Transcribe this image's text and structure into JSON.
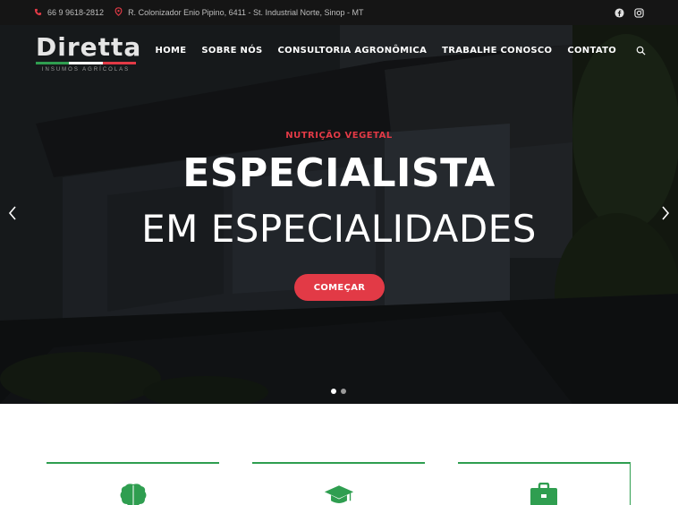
{
  "topbar": {
    "phone": "66 9 9618-2812",
    "address": "R. Colonizador Enio Pipino, 6411 - St. Industrial Norte, Sinop - MT",
    "socials": [
      "facebook-icon",
      "instagram-icon"
    ]
  },
  "brand": {
    "name": "Diretta",
    "tagline": "INSUMOS AGRÍCOLAS",
    "colors": {
      "green": "#2f9e50",
      "white": "#ffffff",
      "red": "#e23a46"
    }
  },
  "nav": {
    "items": [
      "HOME",
      "SOBRE NÓS",
      "CONSULTORIA AGRONÔMICA",
      "TRABALHE CONOSCO",
      "CONTATO"
    ]
  },
  "hero": {
    "eyebrow": "NUTRIÇÃO VEGETAL",
    "title_line1": "ESPECIALISTA",
    "title_line2": "EM ESPECIALIDADES",
    "cta": "COMEÇAR",
    "slides": 2,
    "active_slide": 1
  },
  "features": {
    "icons": [
      "brain-icon",
      "graduation-cap-icon",
      "briefcase-icon"
    ]
  },
  "colors": {
    "accent": "#e23a46",
    "green": "#2f9e50",
    "topbar": "#151515"
  }
}
